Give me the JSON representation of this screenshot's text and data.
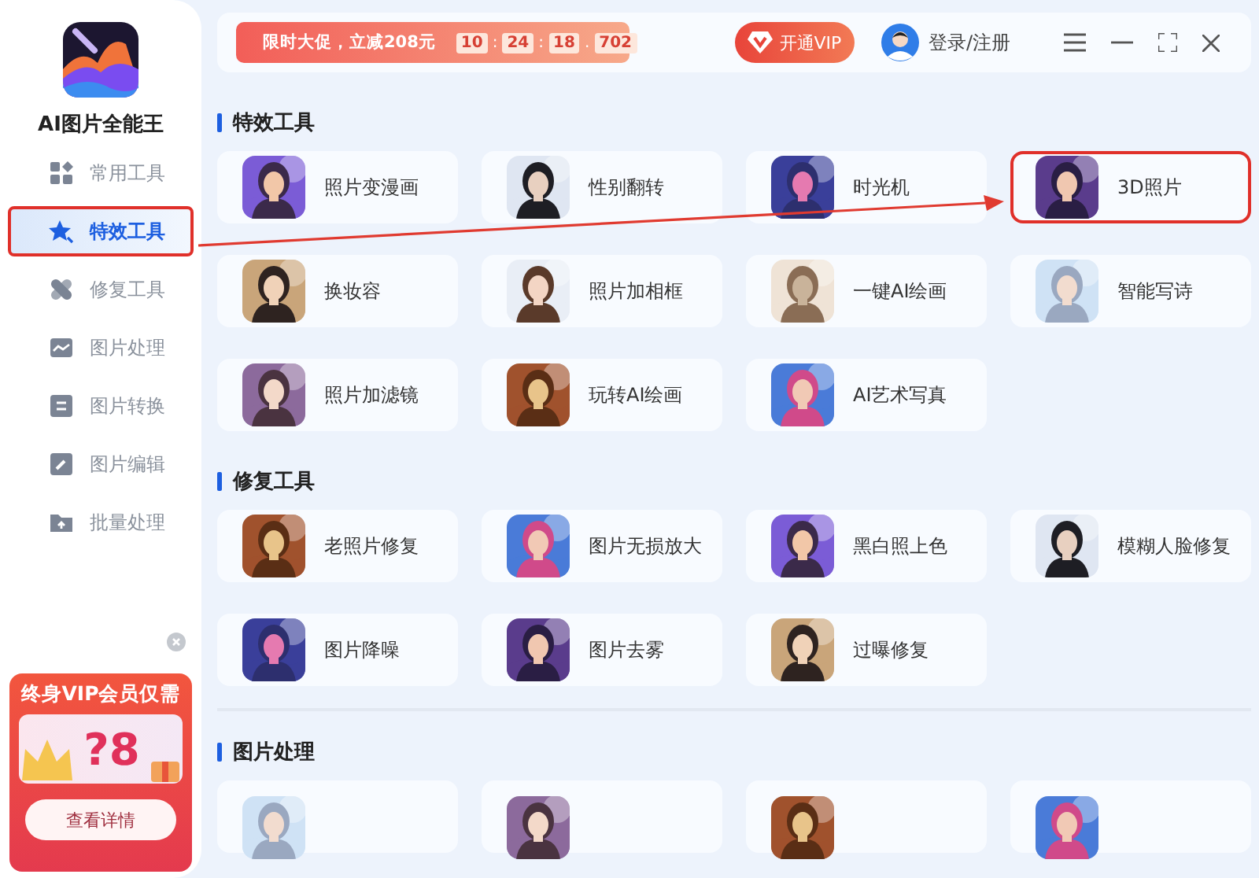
{
  "app": {
    "name": "AI图片全能王"
  },
  "topbar": {
    "promo": {
      "text": "限时大促，立减208元",
      "countdown": [
        {
          "value": "10",
          "sep": ":"
        },
        {
          "value": "24",
          "sep": ":"
        },
        {
          "value": "18",
          "sep": "."
        },
        {
          "value": "702"
        }
      ]
    },
    "vip_button": "开通VIP",
    "login": "登录/注册"
  },
  "sidebar": {
    "items": [
      {
        "label": "常用工具",
        "selected": false,
        "highlighted": false
      },
      {
        "label": "特效工具",
        "selected": true,
        "highlighted": true
      },
      {
        "label": "修复工具",
        "selected": false,
        "highlighted": false
      },
      {
        "label": "图片处理",
        "selected": false,
        "highlighted": false
      },
      {
        "label": "图片转换",
        "selected": false,
        "highlighted": false
      },
      {
        "label": "图片编辑",
        "selected": false,
        "highlighted": false
      },
      {
        "label": "批量处理",
        "selected": false,
        "highlighted": false
      }
    ]
  },
  "vip_card": {
    "title": "终身VIP会员仅需",
    "price": "?8",
    "button": "查看详情"
  },
  "sections": [
    {
      "title": "特效工具",
      "cards": [
        {
          "label": "照片变漫画",
          "highlighted": false
        },
        {
          "label": "性别翻转",
          "highlighted": false
        },
        {
          "label": "时光机",
          "highlighted": false
        },
        {
          "label": "3D照片",
          "highlighted": true
        },
        {
          "label": "换妆容",
          "highlighted": false
        },
        {
          "label": "照片加相框",
          "highlighted": false
        },
        {
          "label": "一键AI绘画",
          "highlighted": false
        },
        {
          "label": "智能写诗",
          "highlighted": false
        },
        {
          "label": "照片加滤镜",
          "highlighted": false
        },
        {
          "label": "玩转AI绘画",
          "highlighted": false
        },
        {
          "label": "AI艺术写真",
          "highlighted": false
        }
      ]
    },
    {
      "title": "修复工具",
      "cards": [
        {
          "label": "老照片修复",
          "highlighted": false
        },
        {
          "label": "图片无损放大",
          "highlighted": false
        },
        {
          "label": "黑白照上色",
          "highlighted": false
        },
        {
          "label": "模糊人脸修复",
          "highlighted": false
        },
        {
          "label": "图片降噪",
          "highlighted": false
        },
        {
          "label": "图片去雾",
          "highlighted": false
        },
        {
          "label": "过曝修复",
          "highlighted": false
        }
      ]
    },
    {
      "title": "图片处理"
    }
  ],
  "annotation": {
    "arrow": true
  }
}
